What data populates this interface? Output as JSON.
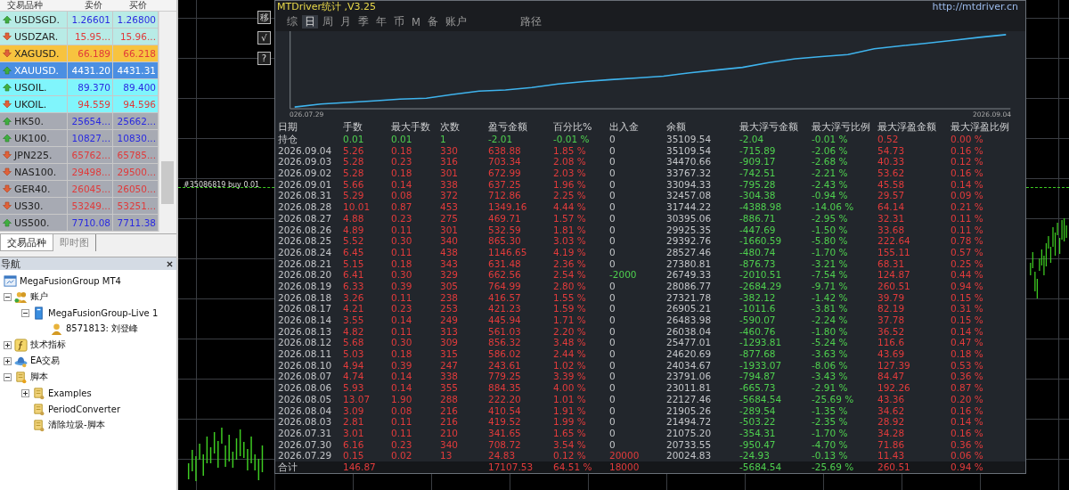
{
  "market_watch": {
    "columns": [
      "交易品种",
      "卖价",
      "买价"
    ],
    "rows": [
      {
        "symbol": "USDSGD.",
        "bid": "1.26601",
        "ask": "1.26800",
        "rising": true,
        "selected": false,
        "color": "#b8ebe6"
      },
      {
        "symbol": "USDZAR.",
        "bid": "15.95...",
        "ask": "15.96...",
        "rising": false,
        "selected": false,
        "color": "#b8ebe6"
      },
      {
        "symbol": "XAGUSD.",
        "bid": "66.189",
        "ask": "66.218",
        "rising": false,
        "selected": false,
        "color": "#f7c33f"
      },
      {
        "symbol": "XAUUSD.",
        "bid": "4431.20",
        "ask": "4431.31",
        "rising": true,
        "selected": true,
        "color": "#4b8fe2"
      },
      {
        "symbol": "USOIL.",
        "bid": "89.370",
        "ask": "89.400",
        "rising": true,
        "selected": false,
        "color": "#80f5fc"
      },
      {
        "symbol": "UKOIL.",
        "bid": "94.559",
        "ask": "94.596",
        "rising": false,
        "selected": false,
        "color": "#80f5fc"
      },
      {
        "symbol": "HK50.",
        "bid": "25654...",
        "ask": "25662...",
        "rising": true,
        "selected": false,
        "color": "#a7aab3"
      },
      {
        "symbol": "UK100.",
        "bid": "10827...",
        "ask": "10830...",
        "rising": true,
        "selected": false,
        "color": "#a7aab3"
      },
      {
        "symbol": "JPN225.",
        "bid": "65762...",
        "ask": "65785...",
        "rising": false,
        "selected": false,
        "color": "#a7aab3"
      },
      {
        "symbol": "NAS100.",
        "bid": "29498...",
        "ask": "29500...",
        "rising": false,
        "selected": false,
        "color": "#a7aab3"
      },
      {
        "symbol": "GER40.",
        "bid": "26045...",
        "ask": "26050...",
        "rising": false,
        "selected": false,
        "color": "#a7aab3"
      },
      {
        "symbol": "US30.",
        "bid": "53249...",
        "ask": "53251...",
        "rising": false,
        "selected": false,
        "color": "#a7aab3"
      },
      {
        "symbol": "US500.",
        "bid": "7710.08",
        "ask": "7711.38",
        "rising": true,
        "selected": false,
        "color": "#a7aab3"
      }
    ],
    "tabs": [
      {
        "label": "交易品种",
        "selected": true
      },
      {
        "label": "即时图",
        "selected": false
      }
    ]
  },
  "navigator": {
    "title": "导航",
    "items": [
      {
        "label": "MegaFusionGroup MT4",
        "kind": "terminal",
        "children": [
          {
            "label": "账户",
            "kind": "accounts",
            "expanded": true,
            "children": [
              {
                "label": "MegaFusionGroup-Live 1",
                "kind": "server",
                "expanded": true,
                "children": [
                  {
                    "label": "8571813: 刘登峰",
                    "kind": "user"
                  }
                ]
              }
            ]
          },
          {
            "label": "技术指标",
            "kind": "indicators",
            "expanded": false
          },
          {
            "label": "EA交易",
            "kind": "experts",
            "expanded": false
          },
          {
            "label": "脚本",
            "kind": "scripts",
            "expanded": true,
            "children": [
              {
                "label": "Examples",
                "kind": "script",
                "expanded": false
              },
              {
                "label": "PeriodConverter",
                "kind": "script"
              },
              {
                "label": "清除垃圾-脚本",
                "kind": "script"
              }
            ]
          }
        ]
      }
    ]
  },
  "chart": {
    "order_label": "#35086819 buy 0.01"
  },
  "stats": {
    "title": "MTDriver统计 ,V3.25",
    "url": "http://mtdriver.cn",
    "side_buttons": [
      "移",
      "√",
      "?"
    ],
    "tabs": [
      {
        "label": "综",
        "selected": false
      },
      {
        "label": "日",
        "selected": true
      },
      {
        "label": "周",
        "selected": false
      },
      {
        "label": "月",
        "selected": false
      },
      {
        "label": "季",
        "selected": false
      },
      {
        "label": "年",
        "selected": false
      },
      {
        "label": "币",
        "selected": false
      },
      {
        "label": "M",
        "selected": false
      },
      {
        "label": "备",
        "selected": false
      },
      {
        "label": "账户",
        "selected": false
      },
      {
        "label": "路径",
        "selected": false
      }
    ],
    "equity_chart": {
      "start_label": "026.07.29",
      "end_label": "2026.09.04"
    },
    "table": {
      "columns": [
        "日期",
        "手数",
        "最大手数",
        "次数",
        "盈亏金额",
        "百分比%",
        "出入金",
        "余额",
        "最大浮亏金额",
        "最大浮亏比例",
        "最大浮盈金额",
        "最大浮盈比例"
      ],
      "rows": [
        {
          "kind": "holding",
          "cells": [
            "持仓",
            "0.01",
            "0.01",
            "1",
            "-2.01",
            "-0.01 %",
            "0",
            "35109.54",
            "-2.04",
            "-0.01 %",
            "0.52",
            "0.00 %"
          ]
        },
        {
          "kind": "day",
          "cells": [
            "2026.09.04",
            "5.26",
            "0.18",
            "330",
            "638.88",
            "1.85 %",
            "0",
            "35109.54",
            "-715.89",
            "-2.06 %",
            "54.73",
            "0.16 %"
          ]
        },
        {
          "kind": "day",
          "cells": [
            "2026.09.03",
            "5.28",
            "0.23",
            "316",
            "703.34",
            "2.08 %",
            "0",
            "34470.66",
            "-909.17",
            "-2.68 %",
            "40.33",
            "0.12 %"
          ]
        },
        {
          "kind": "day",
          "cells": [
            "2026.09.02",
            "5.28",
            "0.18",
            "301",
            "672.99",
            "2.03 %",
            "0",
            "33767.32",
            "-742.51",
            "-2.21 %",
            "53.62",
            "0.16 %"
          ]
        },
        {
          "kind": "day",
          "cells": [
            "2026.09.01",
            "5.66",
            "0.14",
            "338",
            "637.25",
            "1.96 %",
            "0",
            "33094.33",
            "-795.28",
            "-2.43 %",
            "45.58",
            "0.14 %"
          ]
        },
        {
          "kind": "day",
          "cells": [
            "2026.08.31",
            "5.29",
            "0.08",
            "372",
            "712.86",
            "2.25 %",
            "0",
            "32457.08",
            "-304.38",
            "-0.94 %",
            "29.57",
            "0.09 %"
          ]
        },
        {
          "kind": "day",
          "cells": [
            "2026.08.28",
            "10.01",
            "0.87",
            "453",
            "1349.16",
            "4.44 %",
            "0",
            "31744.22",
            "-4388.98",
            "-14.06 %",
            "64.14",
            "0.21 %"
          ]
        },
        {
          "kind": "day",
          "cells": [
            "2026.08.27",
            "4.88",
            "0.23",
            "275",
            "469.71",
            "1.57 %",
            "0",
            "30395.06",
            "-886.71",
            "-2.95 %",
            "32.31",
            "0.11 %"
          ]
        },
        {
          "kind": "day",
          "cells": [
            "2026.08.26",
            "4.89",
            "0.11",
            "301",
            "532.59",
            "1.81 %",
            "0",
            "29925.35",
            "-447.69",
            "-1.50 %",
            "33.68",
            "0.11 %"
          ]
        },
        {
          "kind": "day",
          "cells": [
            "2026.08.25",
            "5.52",
            "0.30",
            "340",
            "865.30",
            "3.03 %",
            "0",
            "29392.76",
            "-1660.59",
            "-5.80 %",
            "222.64",
            "0.78 %"
          ]
        },
        {
          "kind": "day",
          "cells": [
            "2026.08.24",
            "6.45",
            "0.11",
            "438",
            "1146.65",
            "4.19 %",
            "0",
            "28527.46",
            "-480.74",
            "-1.70 %",
            "155.11",
            "0.57 %"
          ]
        },
        {
          "kind": "day",
          "cells": [
            "2026.08.21",
            "5.15",
            "0.18",
            "343",
            "631.48",
            "2.36 %",
            "0",
            "27380.81",
            "-876.73",
            "-3.21 %",
            "68.31",
            "0.25 %"
          ]
        },
        {
          "kind": "day",
          "color": "#4fd04f",
          "cells": [
            "2026.08.20",
            "6.41",
            "0.30",
            "329",
            "662.56",
            "2.54 %",
            "-2000",
            "26749.33",
            "-2010.51",
            "-7.54 %",
            "124.87",
            "0.44 %"
          ]
        },
        {
          "kind": "day",
          "cells": [
            "2026.08.19",
            "6.33",
            "0.39",
            "305",
            "764.99",
            "2.80 %",
            "0",
            "28086.77",
            "-2684.29",
            "-9.71 %",
            "260.51",
            "0.94 %"
          ]
        },
        {
          "kind": "day",
          "cells": [
            "2026.08.18",
            "3.26",
            "0.11",
            "238",
            "416.57",
            "1.55 %",
            "0",
            "27321.78",
            "-382.12",
            "-1.42 %",
            "39.79",
            "0.15 %"
          ]
        },
        {
          "kind": "day",
          "cells": [
            "2026.08.17",
            "4.21",
            "0.23",
            "253",
            "421.23",
            "1.59 %",
            "0",
            "26905.21",
            "-1011.6",
            "-3.81 %",
            "82.19",
            "0.31 %"
          ]
        },
        {
          "kind": "day",
          "cells": [
            "2026.08.14",
            "3.55",
            "0.14",
            "249",
            "445.94",
            "1.71 %",
            "0",
            "26483.98",
            "-590.07",
            "-2.24 %",
            "37.78",
            "0.15 %"
          ]
        },
        {
          "kind": "day",
          "cells": [
            "2026.08.13",
            "4.82",
            "0.11",
            "313",
            "561.03",
            "2.20 %",
            "0",
            "26038.04",
            "-460.76",
            "-1.80 %",
            "36.52",
            "0.14 %"
          ]
        },
        {
          "kind": "day",
          "cells": [
            "2026.08.12",
            "5.68",
            "0.30",
            "309",
            "856.32",
            "3.48 %",
            "0",
            "25477.01",
            "-1293.81",
            "-5.24 %",
            "116.6",
            "0.47 %"
          ]
        },
        {
          "kind": "day",
          "cells": [
            "2026.08.11",
            "5.03",
            "0.18",
            "315",
            "586.02",
            "2.44 %",
            "0",
            "24620.69",
            "-877.68",
            "-3.63 %",
            "43.69",
            "0.18 %"
          ]
        },
        {
          "kind": "day",
          "cells": [
            "2026.08.10",
            "4.94",
            "0.39",
            "247",
            "243.61",
            "1.02 %",
            "0",
            "24034.67",
            "-1933.07",
            "-8.06 %",
            "127.39",
            "0.53 %"
          ]
        },
        {
          "kind": "day",
          "cells": [
            "2026.08.07",
            "4.74",
            "0.14",
            "338",
            "779.25",
            "3.39 %",
            "0",
            "23791.06",
            "-794.87",
            "-3.43 %",
            "84.47",
            "0.36 %"
          ]
        },
        {
          "kind": "day",
          "cells": [
            "2026.08.06",
            "5.93",
            "0.14",
            "355",
            "884.35",
            "4.00 %",
            "0",
            "23011.81",
            "-665.73",
            "-2.91 %",
            "192.26",
            "0.87 %"
          ]
        },
        {
          "kind": "day",
          "cells": [
            "2026.08.05",
            "13.07",
            "1.90",
            "288",
            "222.20",
            "1.01 %",
            "0",
            "22127.46",
            "-5684.54",
            "-25.69 %",
            "43.36",
            "0.20 %"
          ]
        },
        {
          "kind": "day",
          "cells": [
            "2026.08.04",
            "3.09",
            "0.08",
            "216",
            "410.54",
            "1.91 %",
            "0",
            "21905.26",
            "-289.54",
            "-1.35 %",
            "34.62",
            "0.16 %"
          ]
        },
        {
          "kind": "day",
          "cells": [
            "2026.08.03",
            "2.81",
            "0.11",
            "216",
            "419.52",
            "1.99 %",
            "0",
            "21494.72",
            "-503.22",
            "-2.35 %",
            "28.92",
            "0.14 %"
          ]
        },
        {
          "kind": "day",
          "cells": [
            "2026.07.31",
            "3.01",
            "0.11",
            "210",
            "341.65",
            "1.65 %",
            "0",
            "21075.20",
            "-354.31",
            "-1.70 %",
            "34.28",
            "0.16 %"
          ]
        },
        {
          "kind": "day",
          "cells": [
            "2026.07.30",
            "6.16",
            "0.23",
            "340",
            "708.72",
            "3.54 %",
            "0",
            "20733.55",
            "-950.47",
            "-4.70 %",
            "71.86",
            "0.36 %"
          ]
        },
        {
          "kind": "day",
          "color": "#e23b3b",
          "cells": [
            "2026.07.29",
            "0.15",
            "0.02",
            "13",
            "24.83",
            "0.12 %",
            "20000",
            "20024.83",
            "-24.93",
            "-0.13 %",
            "11.43",
            "0.06 %"
          ]
        },
        {
          "kind": "total",
          "color": "#e23b3b",
          "cells": [
            "合计",
            "146.87",
            null,
            null,
            "17107.53",
            "64.51 %",
            "18000",
            null,
            "-5684.54",
            "-25.69 %",
            "260.51",
            "0.94 %"
          ]
        }
      ]
    }
  }
}
